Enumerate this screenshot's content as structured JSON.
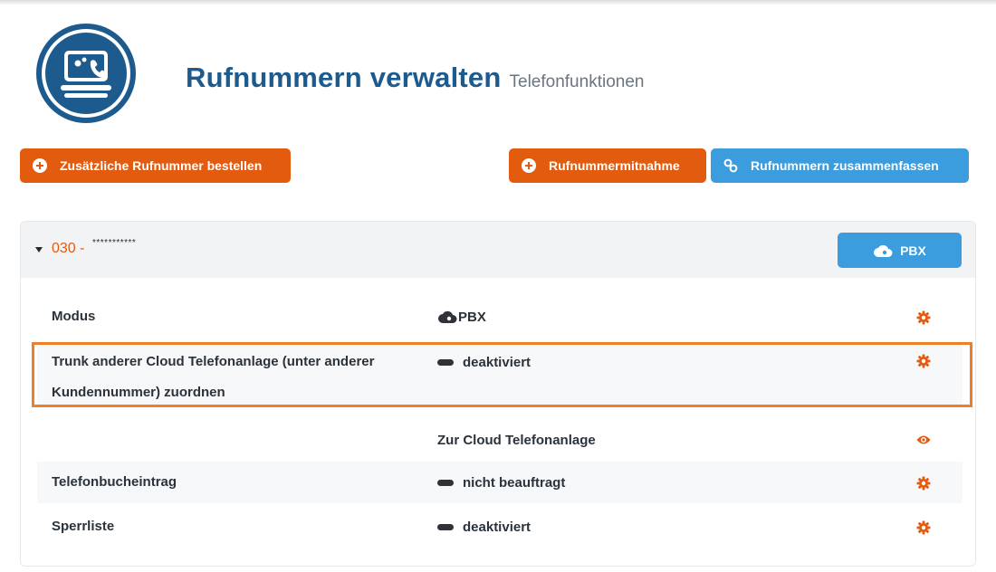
{
  "header": {
    "title": "Rufnummern verwalten",
    "subtitle": "Telefonfunktionen",
    "logo_icon": "computer-phone-icon"
  },
  "actions": {
    "order_label": "Zusätzliche Rufnummer bestellen",
    "porting_label": "Rufnummermitnahme",
    "merge_label": "Rufnummern zusammenfassen"
  },
  "number_panel": {
    "prefix": "030 -",
    "masked_number": "***********",
    "mode_button_label": "PBX",
    "rows": [
      {
        "label": "Modus",
        "value": "PBX",
        "value_icon": "cloud-icon",
        "action_icon": "gear-icon"
      },
      {
        "label_line1": "Trunk anderer Cloud Telefonanlage (unter anderer",
        "label_line2": "Kundennummer) zuordnen",
        "value": "deaktiviert",
        "action_icon": "gear-icon"
      },
      {
        "label": "",
        "value": "Zur Cloud Telefonanlage",
        "action_icon": "eye-icon"
      },
      {
        "label": "Telefonbucheintrag",
        "value": "nicht beauftragt",
        "action_icon": "gear-icon"
      },
      {
        "label": "Sperrliste",
        "value": "deaktiviert",
        "action_icon": "gear-icon"
      }
    ]
  },
  "colors": {
    "brand_blue": "#1d5b8e",
    "button_blue": "#3b9cde",
    "accent_orange": "#e35b0f",
    "highlight_orange": "#f07e26"
  }
}
